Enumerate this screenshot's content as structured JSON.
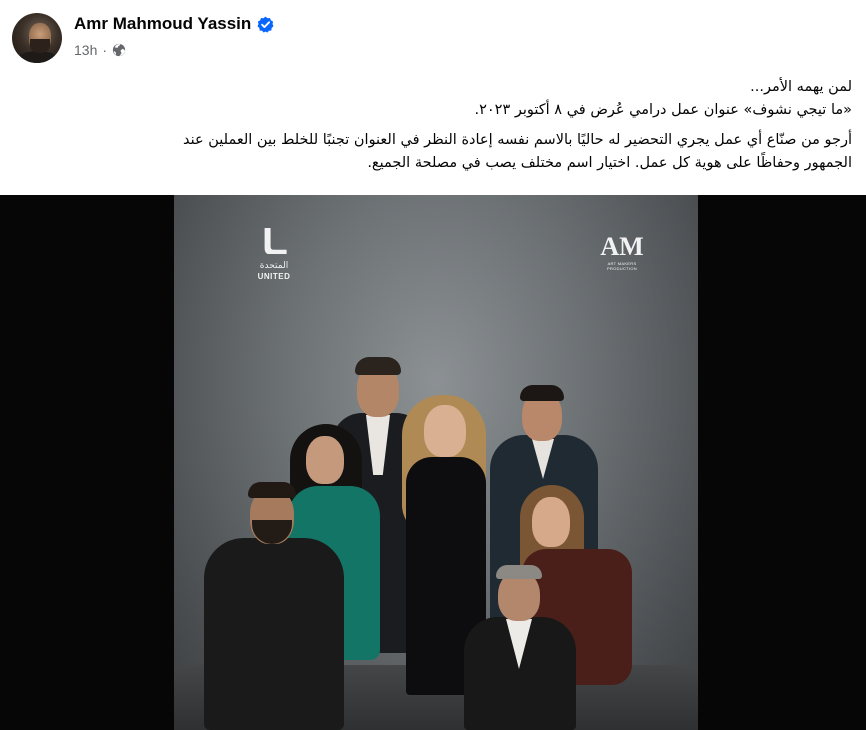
{
  "post": {
    "author_name": "Amr Mahmoud Yassin",
    "timestamp": "13h",
    "separator": "·",
    "text_line1": "لمن يهمه الأمر...",
    "text_line2": "«ما تيجي نشوف» عنوان عمل درامي عُرض في ٨ أكتوبر ٢٠٢٣.",
    "text_line3": "أرجو من صنّاع أي عمل يجري التحضير له حاليًا بالاسم نفسه إعادة النظر في العنوان تجنبًا للخلط بين العملين عند",
    "text_line4": "الجمهور وحفاظًا على هوية كل عمل. اختيار اسم مختلف يصب في مصلحة الجميع."
  },
  "poster": {
    "logo_left_ar": "المتحدة",
    "logo_left_en": "UNITED",
    "logo_right_mark": "AM",
    "logo_right_sub": "ART MAKERS PRODUCTION"
  },
  "icons": {
    "verified": "verified-badge-icon",
    "audience": "globe-icon"
  },
  "colors": {
    "verified_blue": "#0866ff",
    "text_primary": "#050505",
    "text_secondary": "#65676b",
    "photo_background": "#060606"
  }
}
